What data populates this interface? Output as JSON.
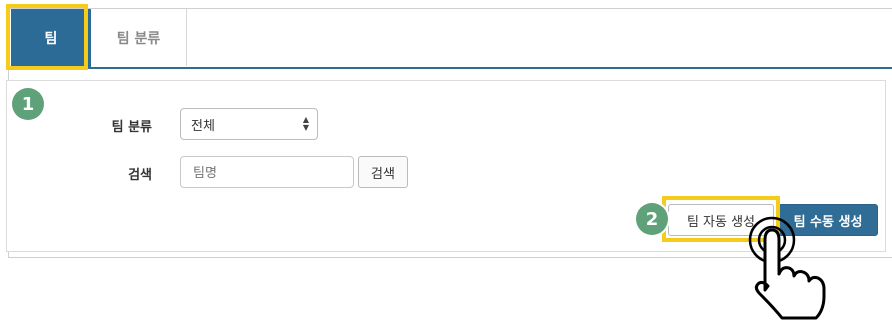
{
  "tabs": [
    {
      "label": "팀",
      "active": true
    },
    {
      "label": "팀 분류",
      "active": false
    }
  ],
  "form": {
    "category_label": "팀 분류",
    "category_value": "전체",
    "search_label": "검색",
    "search_placeholder": "팀명",
    "search_button": "검색"
  },
  "actions": {
    "auto_create": "팀 자동 생성",
    "manual_create": "팀 수동 생성"
  },
  "steps": [
    "1",
    "2"
  ],
  "colors": {
    "accent": "#2d6b97",
    "highlight": "#f5cc1c",
    "step_badge": "#5fa27a"
  },
  "icons": [
    "select-arrows-icon",
    "pointer-hand-icon"
  ]
}
